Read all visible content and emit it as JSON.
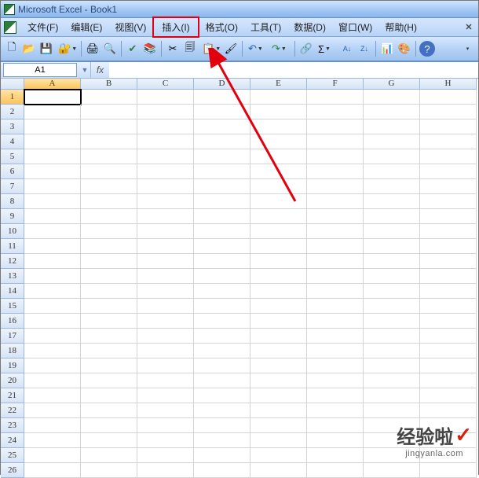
{
  "title": "Microsoft Excel - Book1",
  "menus": {
    "file": "文件(F)",
    "edit": "编辑(E)",
    "view": "视图(V)",
    "insert": "插入(I)",
    "format": "格式(O)",
    "tools": "工具(T)",
    "data": "数据(D)",
    "window": "窗口(W)",
    "help": "帮助(H)"
  },
  "namebox": {
    "value": "A1"
  },
  "fx": {
    "label": "fx",
    "value": ""
  },
  "toolbar_icons": {
    "new": "🗋",
    "open": "📂",
    "save": "💾",
    "permission": "🔐",
    "print": "🖨",
    "preview": "🔍",
    "spell": "✔",
    "research": "📚",
    "cut": "✂",
    "copy": "🗐",
    "paste": "📋",
    "painter": "🖌",
    "undo": "↶",
    "redo": "↷",
    "hyperlink": "🔗",
    "sum": "Σ",
    "sort_asc": "A↓",
    "sort_desc": "Z↓",
    "chart": "📊",
    "draw": "🎨",
    "help": "?"
  },
  "columns": [
    "A",
    "B",
    "C",
    "D",
    "E",
    "F",
    "G",
    "H"
  ],
  "visible_rows": 26,
  "selected_cell": {
    "col": "A",
    "row": 1
  },
  "watermark": {
    "main": "经验啦",
    "sub": "jingyanla.com"
  }
}
